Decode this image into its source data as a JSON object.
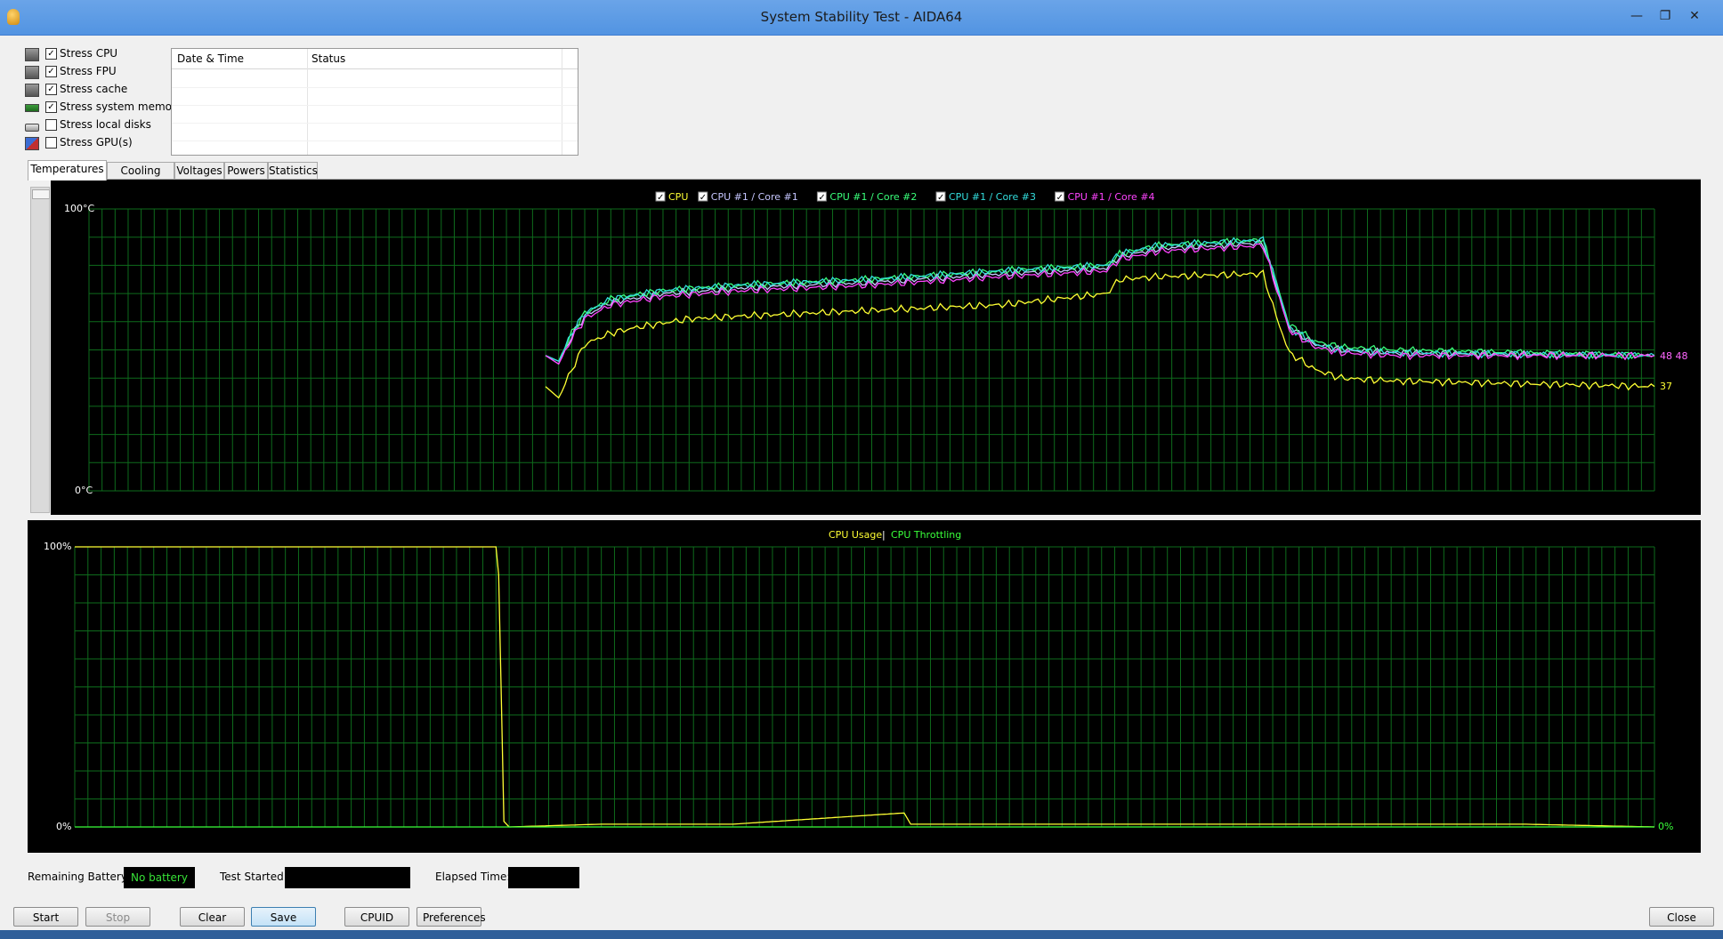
{
  "window": {
    "title": "System Stability Test - AIDA64"
  },
  "stress_options": [
    {
      "label": "Stress CPU",
      "checked": true,
      "icon": "cpu-chip-icon"
    },
    {
      "label": "Stress FPU",
      "checked": true,
      "icon": "fpu-chip-icon"
    },
    {
      "label": "Stress cache",
      "checked": true,
      "icon": "cache-chip-icon"
    },
    {
      "label": "Stress system memory",
      "checked": true,
      "icon": "memory-module-icon"
    },
    {
      "label": "Stress local disks",
      "checked": false,
      "icon": "disk-drive-icon"
    },
    {
      "label": "Stress GPU(s)",
      "checked": false,
      "icon": "gpu-card-icon"
    }
  ],
  "log": {
    "columns": [
      "Date & Time",
      "Status"
    ],
    "rows": []
  },
  "tabs": [
    "Temperatures",
    "Cooling Fans",
    "Voltages",
    "Powers",
    "Statistics"
  ],
  "active_tab": "Temperatures",
  "temperature_chart": {
    "legend": [
      {
        "name": "CPU",
        "color": "#ffff33"
      },
      {
        "name": "CPU #1 / Core #1",
        "color": "#c6c6ff"
      },
      {
        "name": "CPU #1 / Core #2",
        "color": "#39ff7a"
      },
      {
        "name": "CPU #1 / Core #3",
        "color": "#33dddd"
      },
      {
        "name": "CPU #1 / Core #4",
        "color": "#ff44ff"
      }
    ],
    "y_max_label": "100°C",
    "y_min_label": "0°C",
    "end_value_labels": {
      "cores": "48 48",
      "cpu": "37"
    }
  },
  "usage_chart": {
    "title_usage": "CPU Usage",
    "title_separator": "|",
    "title_throttling": "CPU Throttling",
    "y_max_label": "100%",
    "y_min_label": "0%",
    "end_value_label": "0%"
  },
  "chart_data": [
    {
      "type": "line",
      "y_range": [
        0,
        100
      ],
      "unit": "°C",
      "grid": true,
      "x_slots": 120,
      "series": [
        {
          "name": "CPU",
          "color": "#ffff33",
          "points": [
            [
              35,
              37
            ],
            [
              36,
              33
            ],
            [
              37,
              43
            ],
            [
              38,
              52
            ],
            [
              40,
              56
            ],
            [
              42,
              58
            ],
            [
              46,
              61
            ],
            [
              50,
              62
            ],
            [
              60,
              64
            ],
            [
              70,
              66
            ],
            [
              78,
              70
            ],
            [
              79,
              75
            ],
            [
              82,
              76
            ],
            [
              90,
              77
            ],
            [
              91,
              62
            ],
            [
              92,
              49
            ],
            [
              94,
              43
            ],
            [
              96,
              40
            ],
            [
              100,
              39
            ],
            [
              120,
              37
            ]
          ]
        },
        {
          "name": "CPU #1 / Core #1",
          "color": "#c6c6ff",
          "points": [
            [
              35,
              48
            ],
            [
              36,
              45
            ],
            [
              37,
              55
            ],
            [
              38,
              62
            ],
            [
              40,
              67
            ],
            [
              44,
              70
            ],
            [
              50,
              72
            ],
            [
              60,
              74
            ],
            [
              70,
              77
            ],
            [
              78,
              79
            ],
            [
              79,
              83
            ],
            [
              82,
              86
            ],
            [
              90,
              88
            ],
            [
              91,
              73
            ],
            [
              92,
              58
            ],
            [
              94,
              52
            ],
            [
              96,
              50
            ],
            [
              100,
              49
            ],
            [
              120,
              48
            ]
          ]
        },
        {
          "name": "CPU #1 / Core #2",
          "color": "#39ff7a",
          "points": [
            [
              35,
              48
            ],
            [
              36,
              46
            ],
            [
              37,
              56
            ],
            [
              38,
              63
            ],
            [
              40,
              68
            ],
            [
              44,
              71
            ],
            [
              50,
              73
            ],
            [
              60,
              75
            ],
            [
              70,
              78
            ],
            [
              78,
              80
            ],
            [
              79,
              84
            ],
            [
              82,
              87
            ],
            [
              90,
              89
            ],
            [
              91,
              74
            ],
            [
              92,
              59
            ],
            [
              94,
              53
            ],
            [
              96,
              51
            ],
            [
              100,
              50
            ],
            [
              120,
              48
            ]
          ]
        },
        {
          "name": "CPU #1 / Core #3",
          "color": "#33dddd",
          "points": [
            [
              35,
              48
            ],
            [
              36,
              46
            ],
            [
              37,
              56
            ],
            [
              38,
              63
            ],
            [
              40,
              68
            ],
            [
              44,
              71
            ],
            [
              50,
              73
            ],
            [
              60,
              75
            ],
            [
              70,
              78
            ],
            [
              78,
              80
            ],
            [
              79,
              84
            ],
            [
              82,
              87
            ],
            [
              90,
              89
            ],
            [
              91,
              74
            ],
            [
              92,
              58
            ],
            [
              94,
              52
            ],
            [
              96,
              50
            ],
            [
              100,
              49
            ],
            [
              120,
              48
            ]
          ]
        },
        {
          "name": "CPU #1 / Core #4",
          "color": "#ff44ff",
          "points": [
            [
              35,
              48
            ],
            [
              36,
              45
            ],
            [
              37,
              54
            ],
            [
              38,
              61
            ],
            [
              40,
              66
            ],
            [
              44,
              69
            ],
            [
              50,
              71
            ],
            [
              60,
              73
            ],
            [
              70,
              76
            ],
            [
              78,
              78
            ],
            [
              79,
              82
            ],
            [
              82,
              85
            ],
            [
              90,
              87
            ],
            [
              91,
              72
            ],
            [
              92,
              57
            ],
            [
              94,
              51
            ],
            [
              96,
              49
            ],
            [
              100,
              48
            ],
            [
              120,
              48
            ]
          ]
        }
      ]
    },
    {
      "type": "line",
      "y_range": [
        0,
        100
      ],
      "unit": "%",
      "grid": true,
      "x_slots": 120,
      "series": [
        {
          "name": "CPU Usage",
          "color": "#ffff33",
          "points": [
            [
              0,
              100
            ],
            [
              32,
              100
            ],
            [
              32.2,
              90
            ],
            [
              32.6,
              2
            ],
            [
              33,
              0
            ],
            [
              40,
              1
            ],
            [
              50,
              1
            ],
            [
              63,
              5
            ],
            [
              63.5,
              1
            ],
            [
              80,
              1
            ],
            [
              90,
              1
            ],
            [
              100,
              1
            ],
            [
              110,
              1
            ],
            [
              120,
              0
            ]
          ]
        },
        {
          "name": "CPU Throttling",
          "color": "#39ff3a",
          "points": [
            [
              0,
              0
            ],
            [
              120,
              0
            ]
          ]
        }
      ]
    }
  ],
  "status_bar": {
    "remaining_battery_label": "Remaining Battery:",
    "remaining_battery_value": "No battery",
    "test_started_label": "Test Started:",
    "test_started_value": "",
    "elapsed_time_label": "Elapsed Time:",
    "elapsed_time_value": ""
  },
  "buttons": {
    "start": "Start",
    "stop": "Stop",
    "clear": "Clear",
    "save": "Save",
    "cpuid": "CPUID",
    "preferences": "Preferences",
    "close": "Close"
  }
}
